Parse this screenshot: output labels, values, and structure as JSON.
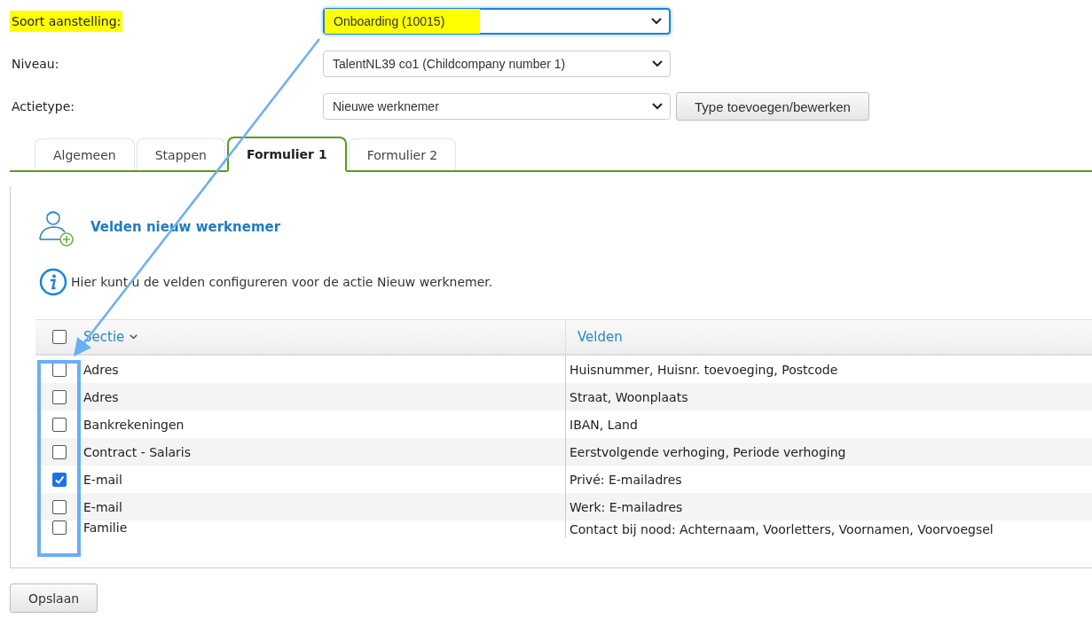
{
  "form": [
    {
      "label": "Soort aanstelling:",
      "value": "Onboarding (10015)",
      "highlighted": true,
      "focused": true
    },
    {
      "label": "Niveau:",
      "value": "TalentNL39 co1 (Childcompany number 1)",
      "highlighted": false,
      "focused": false
    },
    {
      "label": "Actietype:",
      "value": "Nieuwe werknemer",
      "highlighted": false,
      "focused": false,
      "button": "Type toevoegen/bewerken"
    }
  ],
  "tabs": [
    {
      "label": "Algemeen",
      "selected": false
    },
    {
      "label": "Stappen",
      "selected": false
    },
    {
      "label": "Formulier 1",
      "selected": true
    },
    {
      "label": "Formulier 2",
      "selected": false
    }
  ],
  "panel": {
    "title": "Velden nieuw werknemer",
    "info": "Hier kunt u de velden configureren voor de actie Nieuw werknemer.",
    "table": {
      "select_all_checked": false,
      "columns": [
        "Sectie",
        "Velden"
      ],
      "rows": [
        {
          "checked": false,
          "section": "Adres",
          "fields": "Huisnummer, Huisnr. toevoeging, Postcode"
        },
        {
          "checked": false,
          "section": "Adres",
          "fields": "Straat, Woonplaats"
        },
        {
          "checked": false,
          "section": "Bankrekeningen",
          "fields": "IBAN, Land"
        },
        {
          "checked": false,
          "section": "Contract - Salaris",
          "fields": "Eerstvolgende verhoging, Periode verhoging"
        },
        {
          "checked": true,
          "section": "E-mail",
          "fields": "Privé: E-mailadres"
        },
        {
          "checked": false,
          "section": "E-mail",
          "fields": "Werk: E-mailadres"
        },
        {
          "checked": false,
          "section": "Familie",
          "fields": "Contact bij nood: Achternaam, Voorletters, Voornamen, Voorvoegsel"
        }
      ]
    }
  },
  "save_button": "Opslaan"
}
